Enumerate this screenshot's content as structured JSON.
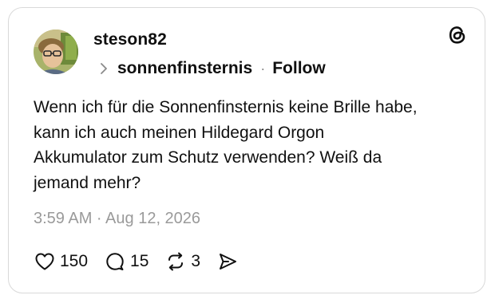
{
  "post": {
    "username": "steson82",
    "topic": "sonnenfinsternis",
    "separator": "·",
    "follow_label": "Follow",
    "text": "Wenn ich für die Sonnenfinsternis keine Brille habe,\nkann ich auch meinen Hildegard Orgon\nAkkumulator zum Schutz verwenden? Weiß da\njemand mehr?",
    "timestamp": "3:59 AM · Aug 12, 2026"
  },
  "actions": {
    "likes": "150",
    "replies": "15",
    "reposts": "3"
  },
  "icons": {
    "brand": "threads-logo-icon",
    "topic_chevron": "chevron-right-icon",
    "like": "heart-icon",
    "reply": "comment-icon",
    "repost": "repost-icon",
    "share": "send-icon"
  }
}
